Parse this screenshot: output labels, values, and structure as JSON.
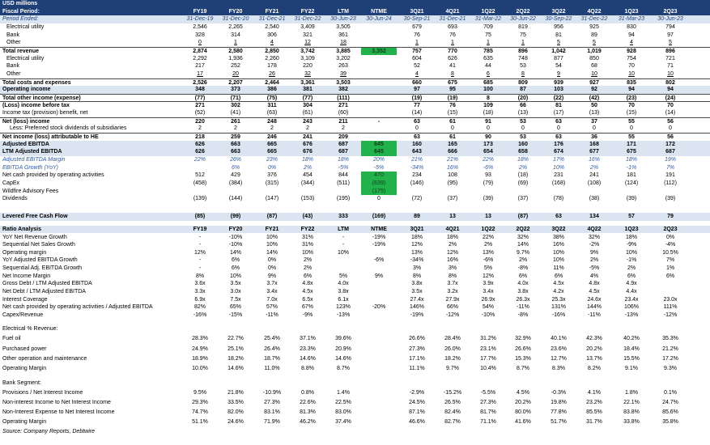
{
  "unit_label": "USD millions",
  "source": "Source: Company Reports, Debtwire",
  "columns": [
    "FY19",
    "FY20",
    "FY21",
    "FY22",
    "LTM",
    "NTME",
    "3Q21",
    "4Q21",
    "1Q22",
    "2Q22",
    "3Q22",
    "4Q22",
    "1Q23",
    "2Q23"
  ],
  "period_ended": [
    "31-Dec-19",
    "31-Dec-20",
    "31-Dec-21",
    "31-Dec-22",
    "30-Jun-23",
    "30-Jun-24",
    "30-Sep-21",
    "31-Dec-21",
    "31-Mar-22",
    "30-Jun-22",
    "30-Sep-22",
    "31-Dec-22",
    "31-Mar-23",
    "30-Jun-23"
  ],
  "header": {
    "fiscal_period": "Fiscal Period:",
    "period_ended_label": "Period Ended:"
  },
  "section1": [
    {
      "label": "Electrical utility",
      "indent": 1,
      "values": [
        "2,546",
        "2,265",
        "2,540",
        "3,409",
        "3,505",
        "",
        "679",
        "693",
        "709",
        "819",
        "956",
        "925",
        "830",
        "794"
      ]
    },
    {
      "label": "Bank",
      "indent": 1,
      "values": [
        "328",
        "314",
        "306",
        "321",
        "361",
        "",
        "76",
        "76",
        "75",
        "75",
        "81",
        "89",
        "94",
        "97"
      ]
    },
    {
      "label": "Other",
      "indent": 1,
      "underline": true,
      "values": [
        "0",
        "1",
        "4",
        "12",
        "18",
        "",
        "1",
        "1",
        "1",
        "1",
        "5",
        "5",
        "4",
        "5"
      ]
    },
    {
      "label": "Total revenue",
      "style": "bold",
      "values": [
        "2,874",
        "2,580",
        "2,850",
        "3,742",
        "3,885",
        "3,352",
        "757",
        "770",
        "785",
        "896",
        "1,042",
        "1,019",
        "928",
        "896"
      ],
      "hl": [
        5
      ]
    },
    {
      "label": "Electrical utility",
      "indent": 1,
      "values": [
        "2,292",
        "1,936",
        "2,260",
        "3,109",
        "3,202",
        "",
        "604",
        "626",
        "635",
        "748",
        "877",
        "850",
        "754",
        "721"
      ]
    },
    {
      "label": "Bank",
      "indent": 1,
      "values": [
        "217",
        "252",
        "178",
        "220",
        "263",
        "",
        "52",
        "41",
        "44",
        "53",
        "54",
        "68",
        "70",
        "71"
      ]
    },
    {
      "label": "Other",
      "indent": 1,
      "underline": true,
      "values": [
        "17",
        "20",
        "26",
        "32",
        "39",
        "",
        "4",
        "8",
        "6",
        "8",
        "9",
        "10",
        "10",
        "10"
      ]
    },
    {
      "label": "Total costs and expenses",
      "style": "bold",
      "values": [
        "2,526",
        "2,207",
        "2,464",
        "3,361",
        "3,503",
        "",
        "660",
        "675",
        "685",
        "809",
        "939",
        "927",
        "835",
        "802"
      ]
    },
    {
      "label": "Operating income",
      "style": "boldband",
      "values": [
        "348",
        "373",
        "386",
        "381",
        "382",
        "",
        "97",
        "95",
        "100",
        "87",
        "103",
        "92",
        "94",
        "94"
      ]
    },
    {
      "label": "Total other income (expense)",
      "style": "bold",
      "values": [
        "(77)",
        "(71)",
        "(75)",
        "(77)",
        "(111)",
        "",
        "(19)",
        "(19)",
        "8",
        "(20)",
        "(22)",
        "(42)",
        "(23)",
        "(24)"
      ]
    },
    {
      "label": "(Loss) income before tax",
      "style": "bold",
      "values": [
        "271",
        "302",
        "311",
        "304",
        "271",
        "",
        "77",
        "76",
        "109",
        "66",
        "81",
        "50",
        "70",
        "70"
      ]
    },
    {
      "label": "Income tax (provision) benefit, net",
      "values": [
        "(52)",
        "(41)",
        "(63)",
        "(61)",
        "(60)",
        "",
        "(14)",
        "(15)",
        "(18)",
        "(13)",
        "(17)",
        "(13)",
        "(15)",
        "(14)"
      ]
    },
    {
      "label": "Net (loss) income",
      "style": "bold",
      "values": [
        "220",
        "261",
        "248",
        "243",
        "211",
        "-",
        "63",
        "61",
        "91",
        "53",
        "63",
        "37",
        "55",
        "56"
      ]
    },
    {
      "label": "Less: Preferred stock dividends of subsidiaries",
      "indent": 2,
      "values": [
        "2",
        "2",
        "2",
        "2",
        "2",
        "",
        "0",
        "0",
        "0",
        "0",
        "0",
        "0",
        "0",
        "0"
      ]
    },
    {
      "label": "Net income (loss) attributable to HE",
      "style": "bold",
      "values": [
        "218",
        "259",
        "246",
        "241",
        "209",
        "",
        "63",
        "61",
        "90",
        "53",
        "63",
        "36",
        "55",
        "56"
      ]
    },
    {
      "label": "Adjusted EBITDA",
      "style": "boldband",
      "values": [
        "626",
        "663",
        "665",
        "676",
        "687",
        "645",
        "160",
        "165",
        "173",
        "160",
        "176",
        "168",
        "171",
        "172"
      ],
      "hl": [
        5
      ]
    },
    {
      "label": "LTM Adjusted EBITDA",
      "style": "boldband",
      "values": [
        "626",
        "663",
        "665",
        "676",
        "687",
        "645",
        "643",
        "666",
        "654",
        "658",
        "674",
        "677",
        "675",
        "687"
      ],
      "hl": [
        5
      ]
    },
    {
      "label": "Adjusted EBITDA Margin",
      "style": "ital",
      "values": [
        "22%",
        "26%",
        "23%",
        "18%",
        "18%",
        "20%",
        "21%",
        "21%",
        "22%",
        "18%",
        "17%",
        "16%",
        "18%",
        "19%"
      ]
    },
    {
      "label": "EBITDA Growth (YoY)",
      "style": "ital",
      "values": [
        "",
        "6%",
        "0%",
        "2%",
        "-5%",
        "-5%",
        "-34%",
        "16%",
        "-6%",
        "2%",
        "10%",
        "2%",
        "-1%",
        "7%"
      ]
    },
    {
      "label": "Net cash provided by operating activities",
      "values": [
        "512",
        "429",
        "376",
        "454",
        "844",
        "470",
        "234",
        "108",
        "93",
        "(18)",
        "231",
        "241",
        "181",
        "191"
      ],
      "hl": [
        5
      ]
    },
    {
      "label": "CapEx",
      "values": [
        "(458)",
        "(384)",
        "(315)",
        "(344)",
        "(511)",
        "(639)",
        "(146)",
        "(95)",
        "(79)",
        "(69)",
        "(168)",
        "(108)",
        "(124)",
        "(112)"
      ],
      "hl": [
        5
      ]
    },
    {
      "label": "Wildfire Advisory Fees",
      "values": [
        "",
        "",
        "",
        "",
        "",
        "(175)",
        "",
        "",
        "",
        "",
        "",
        "",
        "",
        ""
      ],
      "hl": [
        5
      ]
    },
    {
      "label": "Dividends",
      "values": [
        "(139)",
        "(144)",
        "(147)",
        "(153)",
        "(195)",
        "0",
        "(72)",
        "(37)",
        "(39)",
        "(37)",
        "(78)",
        "(38)",
        "(39)",
        "(39)"
      ]
    }
  ],
  "lfcf": {
    "label": "Levered Free Cash Flow",
    "values": [
      "(85)",
      "(99)",
      "(87)",
      "(43)",
      "333",
      "(169)",
      "89",
      "13",
      "13",
      "(87)",
      "63",
      "134",
      "57",
      "79"
    ]
  },
  "ratio_title": "Ratio Analysis",
  "ratios": [
    {
      "label": "YoY Net Revenue Growth",
      "values": [
        "-",
        "-10%",
        "10%",
        "31%",
        "-",
        "-19%",
        "18%",
        "18%",
        "22%",
        "32%",
        "38%",
        "32%",
        "18%",
        "0%"
      ]
    },
    {
      "label": "Sequential Net Sales Growth",
      "values": [
        "-",
        "-10%",
        "10%",
        "31%",
        "-",
        "-19%",
        "12%",
        "2%",
        "2%",
        "14%",
        "16%",
        "-2%",
        "-9%",
        "-4%"
      ]
    },
    {
      "label": "Operating margin",
      "values": [
        "12%",
        "14%",
        "14%",
        "10%",
        "10%",
        "",
        "13%",
        "12%",
        "13%",
        "9.7%",
        "10%",
        "9%",
        "10%",
        "10.5%"
      ]
    },
    {
      "label": "YoY Adjusted EBITDA Growth",
      "values": [
        "-",
        "6%",
        "0%",
        "2%",
        "",
        "-6%",
        "-34%",
        "16%",
        "-6%",
        "2%",
        "10%",
        "2%",
        "-1%",
        "7%"
      ]
    },
    {
      "label": "Sequential Adj. EBITDA Growth",
      "values": [
        "-",
        "6%",
        "0%",
        "2%",
        "",
        "",
        "3%",
        "3%",
        "5%",
        "-8%",
        "11%",
        "-5%",
        "2%",
        "1%"
      ]
    },
    {
      "label": "Net Income Margin",
      "values": [
        "8%",
        "10%",
        "9%",
        "6%",
        "5%",
        "9%",
        "8%",
        "8%",
        "12%",
        "6%",
        "6%",
        "4%",
        "6%",
        "6%"
      ]
    },
    {
      "label": "Gross Debt / LTM Adjusted EBITDA",
      "values": [
        "3.6x",
        "3.5x",
        "3.7x",
        "4.8x",
        "4.0x",
        "",
        "3.8x",
        "3.7x",
        "3.9x",
        "4.0x",
        "4.5x",
        "4.8x",
        "4.9x",
        ""
      ]
    },
    {
      "label": "Net Debt / LTM Adjusted EBITDA",
      "values": [
        "3.3x",
        "3.0x",
        "3.4x",
        "4.5x",
        "3.8x",
        "",
        "3.5x",
        "3.2x",
        "3.4x",
        "3.8x",
        "4.2x",
        "4.5x",
        "4.4x",
        ""
      ]
    },
    {
      "label": "Interest Coverage",
      "values": [
        "6.9x",
        "7.5x",
        "7.0x",
        "6.5x",
        "6.1x",
        "",
        "27.4x",
        "27.9x",
        "26.9x",
        "26.3x",
        "25.3x",
        "24.6x",
        "23.4x",
        "23.0x"
      ]
    },
    {
      "label": "Net cash provided by operating activities / Adjusted EBITDA",
      "values": [
        "82%",
        "65%",
        "57%",
        "67%",
        "123%",
        "-20%",
        "146%",
        "66%",
        "54%",
        "-11%",
        "131%",
        "144%",
        "106%",
        "111%"
      ]
    },
    {
      "label": "Capex/Revenue",
      "values": [
        "-16%",
        "-15%",
        "-11%",
        "-9%",
        "-13%",
        "",
        "-19%",
        "-12%",
        "-10%",
        "-8%",
        "-16%",
        "-11%",
        "-13%",
        "-12%"
      ]
    }
  ],
  "electrical_title": "Electrical % Revenue:",
  "electrical": [
    {
      "label": "Fuel oil",
      "values": [
        "28.3%",
        "22.7%",
        "25.4%",
        "37.1%",
        "39.6%",
        "",
        "26.6%",
        "28.4%",
        "31.2%",
        "32.9%",
        "40.1%",
        "42.3%",
        "40.2%",
        "35.3%"
      ]
    },
    {
      "label": "Purchased power",
      "values": [
        "24.9%",
        "25.1%",
        "26.4%",
        "23.3%",
        "20.9%",
        "",
        "27.3%",
        "26.0%",
        "23.1%",
        "26.6%",
        "23.6%",
        "20.2%",
        "18.4%",
        "21.2%"
      ]
    },
    {
      "label": "Other operation and maintenance",
      "values": [
        "18.9%",
        "18.2%",
        "18.7%",
        "14.6%",
        "14.6%",
        "",
        "17.1%",
        "18.2%",
        "17.7%",
        "15.3%",
        "12.7%",
        "13.7%",
        "15.5%",
        "17.2%"
      ]
    },
    {
      "label": "Operating Margin",
      "values": [
        "10.0%",
        "14.6%",
        "11.0%",
        "8.8%",
        "8.7%",
        "",
        "11.1%",
        "9.7%",
        "10.4%",
        "8.7%",
        "8.3%",
        "8.2%",
        "9.1%",
        "9.3%"
      ]
    }
  ],
  "bank_title": "Bank Segment:",
  "bank": [
    {
      "label": "Provisions / Net Interest Income",
      "values": [
        "9.5%",
        "21.8%",
        "-10.9%",
        "0.8%",
        "1.4%",
        "",
        "-2.9%",
        "-15.2%",
        "-5.5%",
        "4.5%",
        "-0.3%",
        "4.1%",
        "1.8%",
        "0.1%"
      ]
    },
    {
      "label": "Non-interest Income to Net Interest Income",
      "values": [
        "29.3%",
        "33.5%",
        "27.3%",
        "22.6%",
        "22.5%",
        "",
        "24.5%",
        "26.5%",
        "27.3%",
        "20.2%",
        "19.8%",
        "23.2%",
        "22.1%",
        "24.7%"
      ]
    },
    {
      "label": "Non-Interest Expense to Net Interest Income",
      "values": [
        "74.7%",
        "82.0%",
        "83.1%",
        "81.3%",
        "83.0%",
        "",
        "87.1%",
        "82.4%",
        "81.7%",
        "80.0%",
        "77.8%",
        "85.5%",
        "83.8%",
        "85.6%"
      ]
    },
    {
      "label": "Operating Margin",
      "values": [
        "51.1%",
        "24.6%",
        "71.9%",
        "46.2%",
        "37.4%",
        "",
        "46.6%",
        "82.7%",
        "71.1%",
        "41.6%",
        "51.7%",
        "31.7%",
        "33.8%",
        "35.8%"
      ]
    }
  ],
  "colors": {
    "header_bg": "#1f3f77",
    "band_bg": "#dbe5f1",
    "highlight": "#22b24c",
    "italic_text": "#2e5da8"
  }
}
